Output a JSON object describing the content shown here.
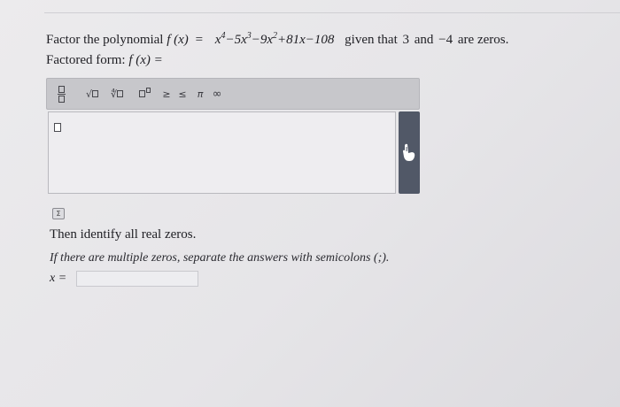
{
  "question": {
    "intro": "Factor the polynomial",
    "function_name": "f (x)",
    "equals": "=",
    "polynomial": {
      "t1_base": "x",
      "t1_exp": "4",
      "t2": "−5x",
      "t2_exp": "3",
      "t3": "−9x",
      "t3_exp": "2",
      "t4": "+81x−108"
    },
    "given_that": "given that",
    "zero_1": "3",
    "and": "and",
    "zero_2": "−4",
    "are_zeros": "are zeros."
  },
  "factored_form_label": "Factored form:",
  "factored_form_function": "f (x) =",
  "toolbar": {
    "icons": [
      "fraction-icon",
      "sqrt-icon",
      "nth-root-icon",
      "exponent-icon",
      "ge-icon",
      "le-icon",
      "pi-icon",
      "infinity-icon"
    ],
    "sqrt_symbol": "√",
    "nroot_symbol": "∜",
    "ge_symbol": "≥",
    "le_symbol": "≤",
    "pi_symbol": "π",
    "infinity_symbol": "∞"
  },
  "sigma_label": "Σ",
  "then_identify": "Then identify all real zeros.",
  "hint": "If there are multiple zeros, separate the answers with semicolons (;).",
  "x_label": "x =",
  "answer_value": ""
}
